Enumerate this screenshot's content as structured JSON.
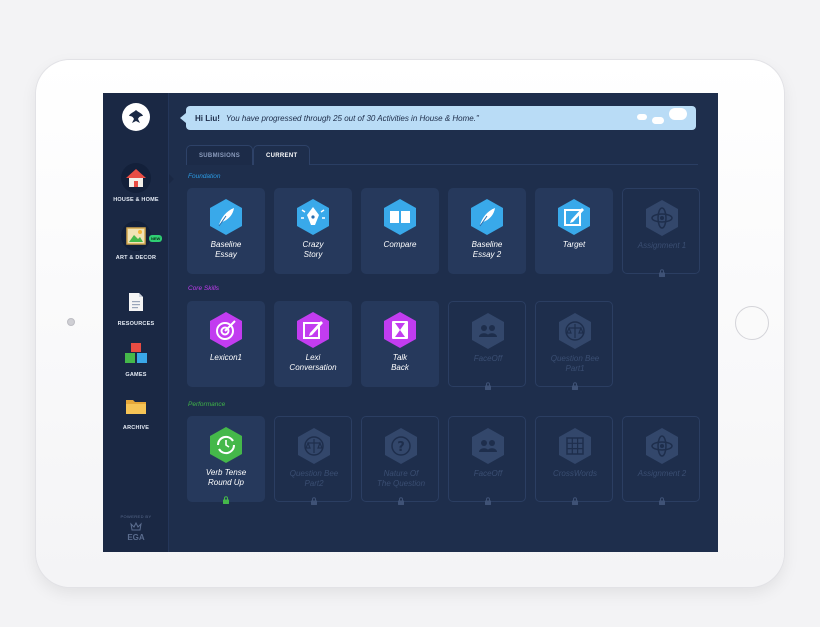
{
  "colors": {
    "screen_bg": "#1e2e4c",
    "card_bg": "#26395c",
    "banner_bg": "#b9dcf6",
    "foundation": "#39a9ea",
    "core": "#c23cf0",
    "performance": "#45b84a",
    "locked": "#33476b"
  },
  "sidebar": {
    "items": [
      {
        "label": "HOUSE & HOME",
        "icon": "house-icon"
      },
      {
        "label": "ART & DECOR",
        "icon": "painting-icon",
        "badge": "NEW"
      },
      {
        "label": "RESOURCES",
        "icon": "document-icon"
      },
      {
        "label": "GAMES",
        "icon": "cubes-icon"
      },
      {
        "label": "ARCHIVE",
        "icon": "folder-icon"
      }
    ],
    "powered_by": "POWERED BY",
    "brand": "EGA"
  },
  "banner": {
    "greeting": "Hi Liu!",
    "message": "You have progressed through 25 out of 30 Activities in House & Home.\""
  },
  "tabs": [
    {
      "label": "SUBMISIONS",
      "active": false
    },
    {
      "label": "CURRENT",
      "active": true
    }
  ],
  "sections": {
    "foundation": {
      "label": "Foundation",
      "cards": [
        {
          "line1": "Baseline",
          "line2": "Essay",
          "icon": "quill-icon",
          "locked": false
        },
        {
          "line1": "Crazy",
          "line2": "Story",
          "icon": "pen-nib-icon",
          "locked": false
        },
        {
          "line1": "Compare",
          "line2": "",
          "icon": "compare-icon",
          "locked": false
        },
        {
          "line1": "Baseline",
          "line2": "Essay 2",
          "icon": "quill-icon",
          "locked": false
        },
        {
          "line1": "Target",
          "line2": "",
          "icon": "edit-square-icon",
          "locked": false
        },
        {
          "line1": "Assignment 1",
          "line2": "",
          "icon": "atom-icon",
          "locked": true
        }
      ]
    },
    "core_skills": {
      "label": "Core Skills",
      "cards": [
        {
          "line1": "Lexicon1",
          "line2": "",
          "icon": "target-icon",
          "locked": false
        },
        {
          "line1": "Lexi",
          "line2": "Conversation",
          "icon": "edit-square-icon",
          "locked": false
        },
        {
          "line1": "Talk",
          "line2": "Back",
          "icon": "hourglass-icon",
          "locked": false
        },
        {
          "line1": "FaceOff",
          "line2": "",
          "icon": "people-icon",
          "locked": true
        },
        {
          "line1": "Question Bee",
          "line2": "Part1",
          "icon": "scales-icon",
          "locked": true
        }
      ]
    },
    "performance": {
      "label": "Performance",
      "cards": [
        {
          "line1": "Verb Tense",
          "line2": "Round Up",
          "icon": "refresh-clock-icon",
          "locked": false,
          "unlocked_badge": true
        },
        {
          "line1": "Question Bee",
          "line2": "Part2",
          "icon": "scales-icon",
          "locked": true
        },
        {
          "line1": "Nature Of",
          "line2": "The Question",
          "icon": "question-icon",
          "locked": true
        },
        {
          "line1": "FaceOff",
          "line2": "",
          "icon": "people-icon",
          "locked": true
        },
        {
          "line1": "CrossWords",
          "line2": "",
          "icon": "crossword-icon",
          "locked": true
        },
        {
          "line1": "Assignment 2",
          "line2": "",
          "icon": "atom-icon",
          "locked": true
        }
      ]
    }
  }
}
